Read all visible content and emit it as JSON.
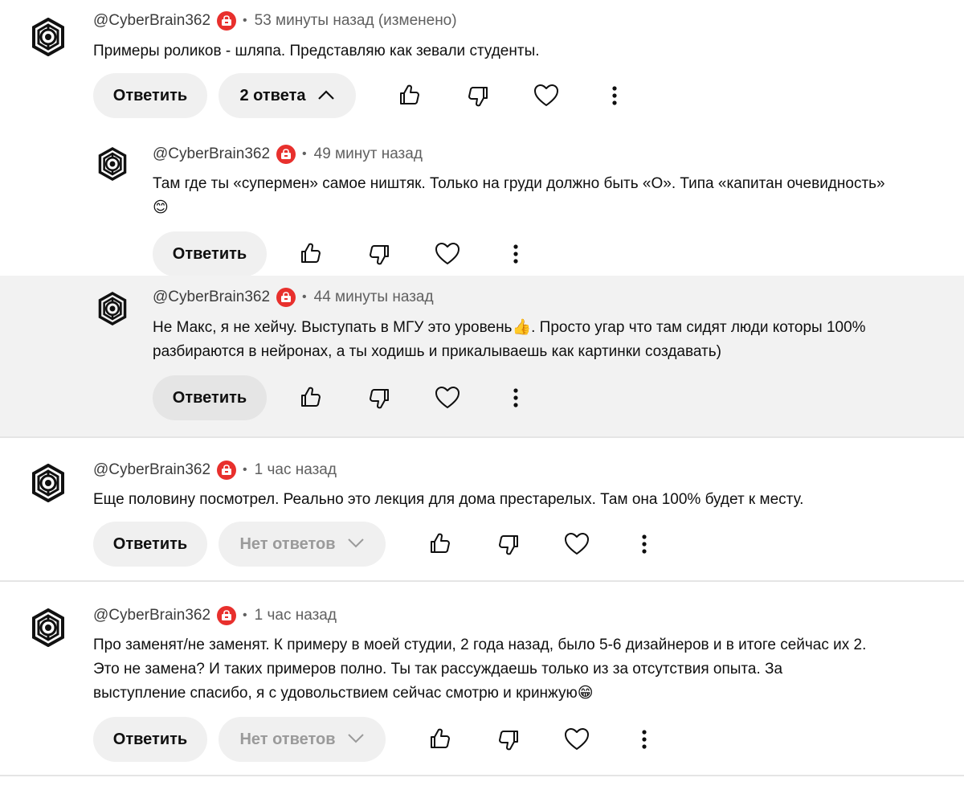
{
  "colors": {
    "badge": "#e8302d",
    "text": "#0f0f0f",
    "secondary": "#606060",
    "pill": "#f0f0f0",
    "highlight": "#f2f2f2"
  },
  "comments": [
    {
      "author": "@CyberBrain362",
      "dot": "•",
      "time": "53 минуты назад (изменено)",
      "text": "Примеры роликов - шляпа. Представляю как зевали студенты.",
      "reply_label": "Ответить",
      "replies_label": "2 ответа",
      "replies_icon": "chevron-up-icon"
    },
    {
      "author": "@CyberBrain362",
      "dot": "•",
      "time": "49 минут назад",
      "text": "Там где ты «супермен» самое ништяк. Только на груди должно быть «О». Типа «капитан очевидность»\n😊",
      "reply_label": "Ответить"
    },
    {
      "author": "@CyberBrain362",
      "dot": "•",
      "time": "44 минуты назад",
      "text": "Не Макс, я не хейчу. Выступать в МГУ это уровень👍. Просто угар что там сидят люди которы 100%\nразбираются в нейронах, а ты ходишь и прикалываешь как картинки создавать)",
      "reply_label": "Ответить"
    },
    {
      "author": "@CyberBrain362",
      "dot": "•",
      "time": "1 час назад",
      "text": "Еще половину посмотрел. Реально это лекция для дома престарелых. Там она 100% будет к месту.",
      "reply_label": "Ответить",
      "replies_label": "Нет ответов",
      "replies_icon": "chevron-down-icon"
    },
    {
      "author": "@CyberBrain362",
      "dot": "•",
      "time": "1 час назад",
      "text": "Про заменят/не заменят. К примеру в моей студии, 2 года назад, было 5-6 дизайнеров и в итоге сейчас их 2.\nЭто не замена? И таких примеров полно. Ты так рассуждаешь только из за отсутствия опыта. За\nвыступление спасибо, я с удовольствием сейчас смотрю и кринжую😁",
      "reply_label": "Ответить",
      "replies_label": "Нет ответов",
      "replies_icon": "chevron-down-icon"
    }
  ]
}
